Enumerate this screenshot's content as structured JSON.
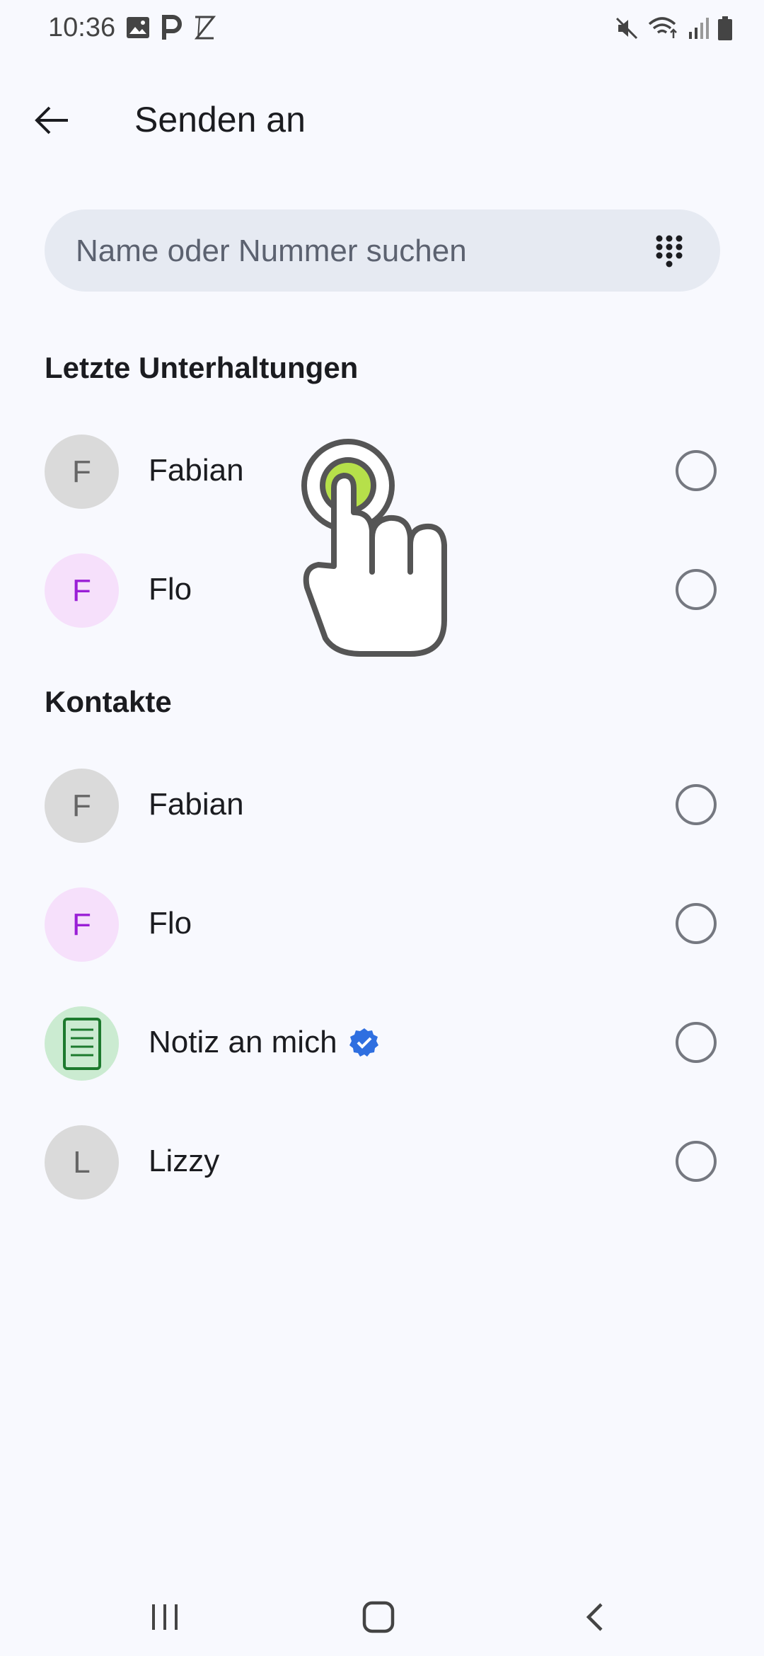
{
  "status_bar": {
    "time": "10:36",
    "left_icons": [
      "image-icon",
      "p-icon",
      "z-icon"
    ],
    "right_icons": [
      "mute-icon",
      "wifi-icon",
      "signal-icon",
      "battery-icon"
    ]
  },
  "app_bar": {
    "title": "Senden an",
    "back_icon": "arrow-back-icon"
  },
  "search": {
    "placeholder": "Name oder Nummer suchen",
    "value": "",
    "dialpad_icon": "dialpad-icon"
  },
  "sections": {
    "recent_title": "Letzte Unterhaltungen",
    "contacts_title": "Kontakte"
  },
  "recent": [
    {
      "initial": "F",
      "name": "Fabian",
      "avatar_color": "#dadada",
      "selected": false
    },
    {
      "initial": "F",
      "name": "Flo",
      "avatar_color": "#f6e0fb",
      "selected": false
    }
  ],
  "contacts": [
    {
      "initial": "F",
      "name": "Fabian",
      "avatar_color": "#dadada",
      "selected": false
    },
    {
      "initial": "F",
      "name": "Flo",
      "avatar_color": "#f6e0fb",
      "selected": false
    },
    {
      "initial": "",
      "name": "Notiz an mich",
      "avatar_icon": "note-icon",
      "avatar_color": "#cbebd1",
      "verified": true,
      "selected": false
    },
    {
      "initial": "L",
      "name": "Lizzy",
      "avatar_color": "#dadada",
      "selected": false
    }
  ],
  "colors": {
    "background": "#f8f9fe",
    "search_background": "#e6eaf2",
    "accent_verified": "#2f6fe0",
    "tap_indicator": "#b6e04a"
  },
  "nav_bar": [
    "recent-apps-icon",
    "home-icon",
    "back-icon"
  ]
}
